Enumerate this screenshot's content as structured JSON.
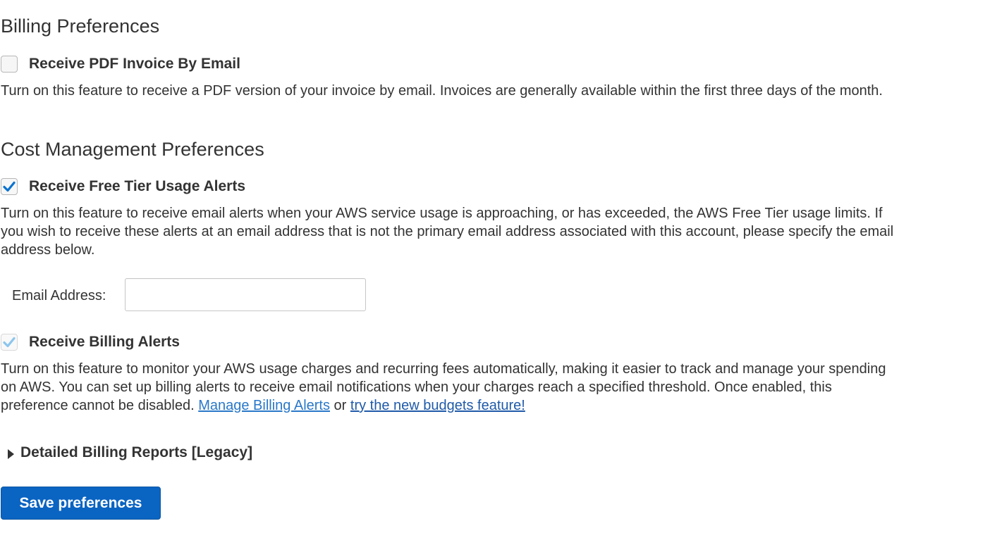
{
  "billing_preferences": {
    "heading": "Billing Preferences",
    "pdf_invoice": {
      "label": "Receive PDF Invoice By Email",
      "checked": false,
      "description": "Turn on this feature to receive a PDF version of your invoice by email. Invoices are generally available within the first three days of the month."
    }
  },
  "cost_management": {
    "heading": "Cost Management Preferences",
    "free_tier_alerts": {
      "label": "Receive Free Tier Usage Alerts",
      "checked": true,
      "description": "Turn on this feature to receive email alerts when your AWS service usage is approaching, or has exceeded, the AWS Free Tier usage limits. If you wish to receive these alerts at an email address that is not the primary email address associated with this account, please specify the email address below."
    },
    "email": {
      "label": "Email Address:",
      "value": "",
      "placeholder": ""
    },
    "billing_alerts": {
      "label": "Receive Billing Alerts",
      "checked": true,
      "disabled": true,
      "description_text": "Turn on this feature to monitor your AWS usage charges and recurring fees automatically, making it easier to track and manage your spending on AWS. You can set up billing alerts to receive email notifications when your charges reach a specified threshold. Once enabled, this preference cannot be disabled.",
      "manage_link": "Manage Billing Alerts",
      "or_text": "or",
      "budgets_link": "try the new budgets feature!"
    }
  },
  "detailed_reports": {
    "label": "Detailed Billing Reports [Legacy]",
    "expanded": false
  },
  "actions": {
    "save_label": "Save preferences"
  },
  "colors": {
    "primary_button": "#0a64c2",
    "checkbox_check": "#0b73d0",
    "checkbox_check_disabled": "#8cc6ee",
    "link": "#2a78c9",
    "text": "#333333"
  },
  "icons": {
    "checkbox": "checkbox-icon",
    "checkmark": "checkmark-icon",
    "disclosure": "caret-right-icon"
  }
}
